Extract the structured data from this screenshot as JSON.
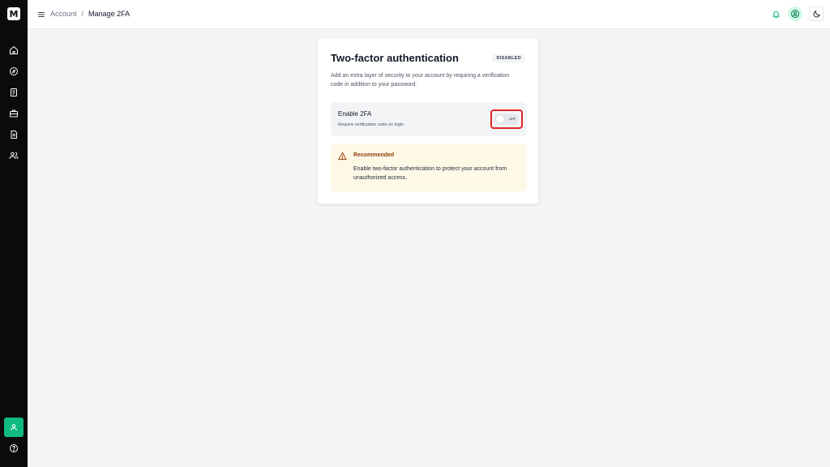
{
  "app": {
    "logo_glyph": "M",
    "accent_color": "#10b981"
  },
  "sidebar": {
    "items": [
      {
        "name": "home",
        "icon": "home-icon"
      },
      {
        "name": "explore",
        "icon": "compass-icon"
      },
      {
        "name": "reports",
        "icon": "clipboard-icon"
      },
      {
        "name": "portfolio",
        "icon": "briefcase-icon"
      },
      {
        "name": "documents",
        "icon": "document-icon"
      },
      {
        "name": "team",
        "icon": "users-icon"
      }
    ],
    "bottom": [
      {
        "name": "account",
        "icon": "user-icon"
      },
      {
        "name": "help",
        "icon": "help-circle-icon"
      }
    ]
  },
  "header": {
    "breadcrumb": {
      "parent": "Account",
      "separator": "/",
      "current": "Manage 2FA"
    }
  },
  "card": {
    "title": "Two-factor authentication",
    "status": "DISABLED",
    "description": "Add an extra layer of security to your account by requiring a verification code in addition to your password.",
    "toggle": {
      "title": "Enable 2FA",
      "subtitle": "Require verification code on login",
      "state_label": "OFF",
      "enabled": false
    },
    "alert": {
      "title": "Recommended",
      "text": "Enable two-factor authentication to protect your account from unauthorized access.",
      "color": "#92400e",
      "background": "#fef8e7"
    }
  }
}
